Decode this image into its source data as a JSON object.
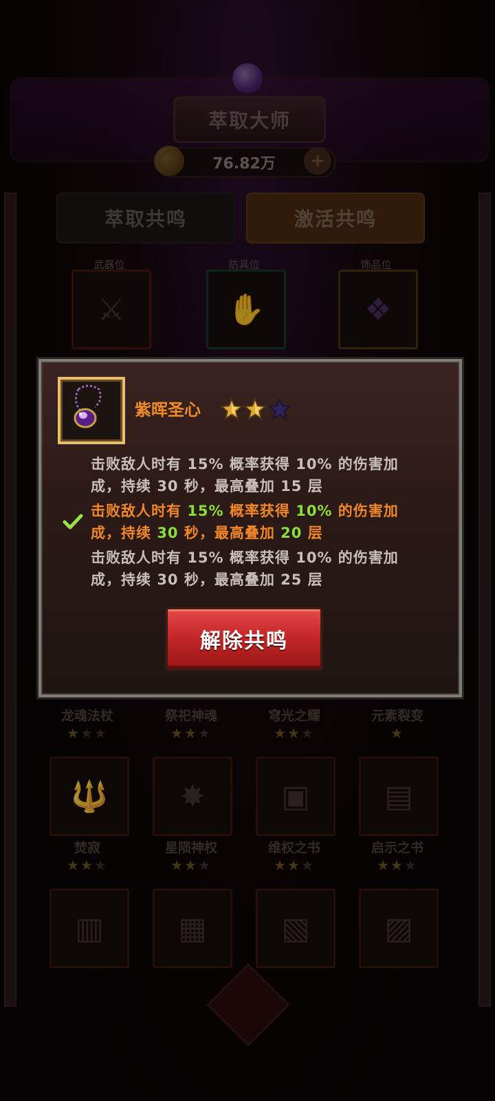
{
  "header": {
    "title": "萃取大师",
    "currency": "76.82万"
  },
  "tabs": [
    {
      "label": "萃取共鸣"
    },
    {
      "label": "激活共鸣"
    }
  ],
  "slots": [
    {
      "label": "武器位"
    },
    {
      "label": "防具位"
    },
    {
      "label": "饰品位"
    }
  ],
  "collection": [
    {
      "name": "龙魂法杖",
      "stars": 1
    },
    {
      "name": "祭祀神魂",
      "stars": 2
    },
    {
      "name": "穹光之耀",
      "stars": 2
    },
    {
      "name": "元素裂变",
      "stars": 1
    },
    {
      "name": "焚寂",
      "stars": 2
    },
    {
      "name": "星陨神权",
      "stars": 2
    },
    {
      "name": "维权之书",
      "stars": 2
    },
    {
      "name": "启示之书",
      "stars": 2
    }
  ],
  "modal": {
    "item_name": "紫晖圣心",
    "stars_filled": 2,
    "stars_total": 3,
    "effects": [
      {
        "l1_pre": "击败敌人时有 ",
        "chance": "15%",
        "l1_mid": " 概率获得 ",
        "bonus": "10%",
        "l1_post": " 的伤害加",
        "l2_pre": "成，持续 ",
        "seconds": "30",
        "l2_mid": " 秒，最高叠加 ",
        "stacks": "15",
        "l2_post": " 层",
        "active": false
      },
      {
        "l1_pre": "击败敌人时有 ",
        "chance": "15%",
        "l1_mid": " 概率获得 ",
        "bonus": "10%",
        "l1_post": " 的伤害加",
        "l2_pre": "成，持续 ",
        "seconds": "30",
        "l2_mid": " 秒，最高叠加 ",
        "stacks": "20",
        "l2_post": " 层",
        "active": true
      },
      {
        "l1_pre": "击败敌人时有 ",
        "chance": "15%",
        "l1_mid": " 概率获得 ",
        "bonus": "10%",
        "l1_post": " 的伤害加",
        "l2_pre": "成，持续 ",
        "seconds": "30",
        "l2_mid": " 秒，最高叠加 ",
        "stacks": "25",
        "l2_post": " 层",
        "active": false
      }
    ],
    "release_button": "解除共鸣"
  },
  "colors": {
    "item_name": "#f08a2a",
    "highlight": "#8adf3a",
    "button": "#c42828",
    "frame_gold": "#e6c070"
  }
}
